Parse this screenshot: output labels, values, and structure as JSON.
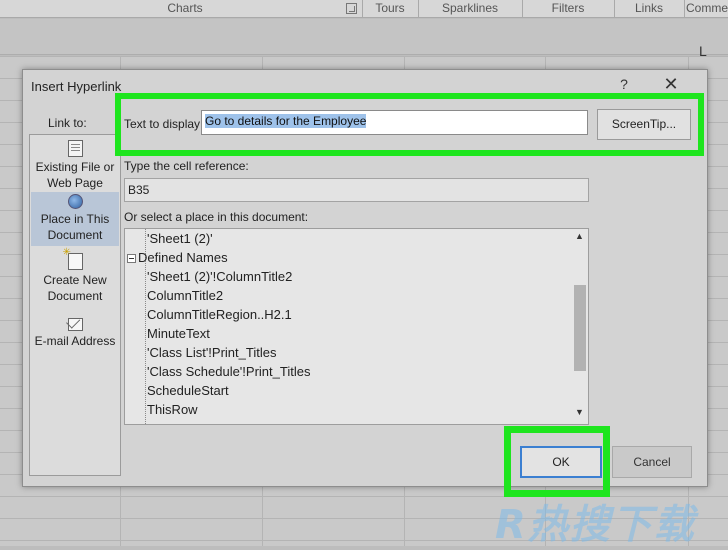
{
  "ribbon": {
    "groups": [
      "Charts",
      "Tours",
      "Sparklines",
      "Filters",
      "Links",
      "Comme"
    ]
  },
  "sheet": {
    "visible_column_letter": "L"
  },
  "dialog": {
    "title": "Insert Hyperlink",
    "help_glyph": "?",
    "close_glyph": "✕",
    "link_to_label": "Link to:",
    "link_items": [
      {
        "line1": "Existing File or",
        "line2": "Web Page",
        "icon": "document-icon",
        "selected": false
      },
      {
        "line1": "Place in This",
        "line2": "Document",
        "icon": "globe-document-icon",
        "selected": true
      },
      {
        "line1": "Create New",
        "line2": "Document",
        "icon": "new-document-icon",
        "selected": false
      },
      {
        "line1": "E-mail Address",
        "line2": "",
        "icon": "email-icon",
        "selected": false
      }
    ],
    "text_to_display_label": "Text to display:",
    "text_to_display_value": "Go to details for the Employee",
    "screentip_label": "ScreenTip...",
    "cell_reference_label": "Type the cell reference:",
    "cell_reference_value": "B35",
    "place_label": "Or select a place in this document:",
    "tree_items": [
      "'Sheet1 (2)'",
      "Defined Names",
      "'Sheet1 (2)'!ColumnTitle2",
      "ColumnTitle2",
      "ColumnTitleRegion..H2.1",
      "MinuteText",
      "'Class List'!Print_Titles",
      "'Class Schedule'!Print_Titles",
      "ScheduleStart",
      "ThisRow"
    ],
    "ok_label": "OK",
    "cancel_label": "Cancel",
    "highlight_color": "#1ee51e",
    "selection_color": "#9ec2ea"
  },
  "watermark": "R热搜下载"
}
